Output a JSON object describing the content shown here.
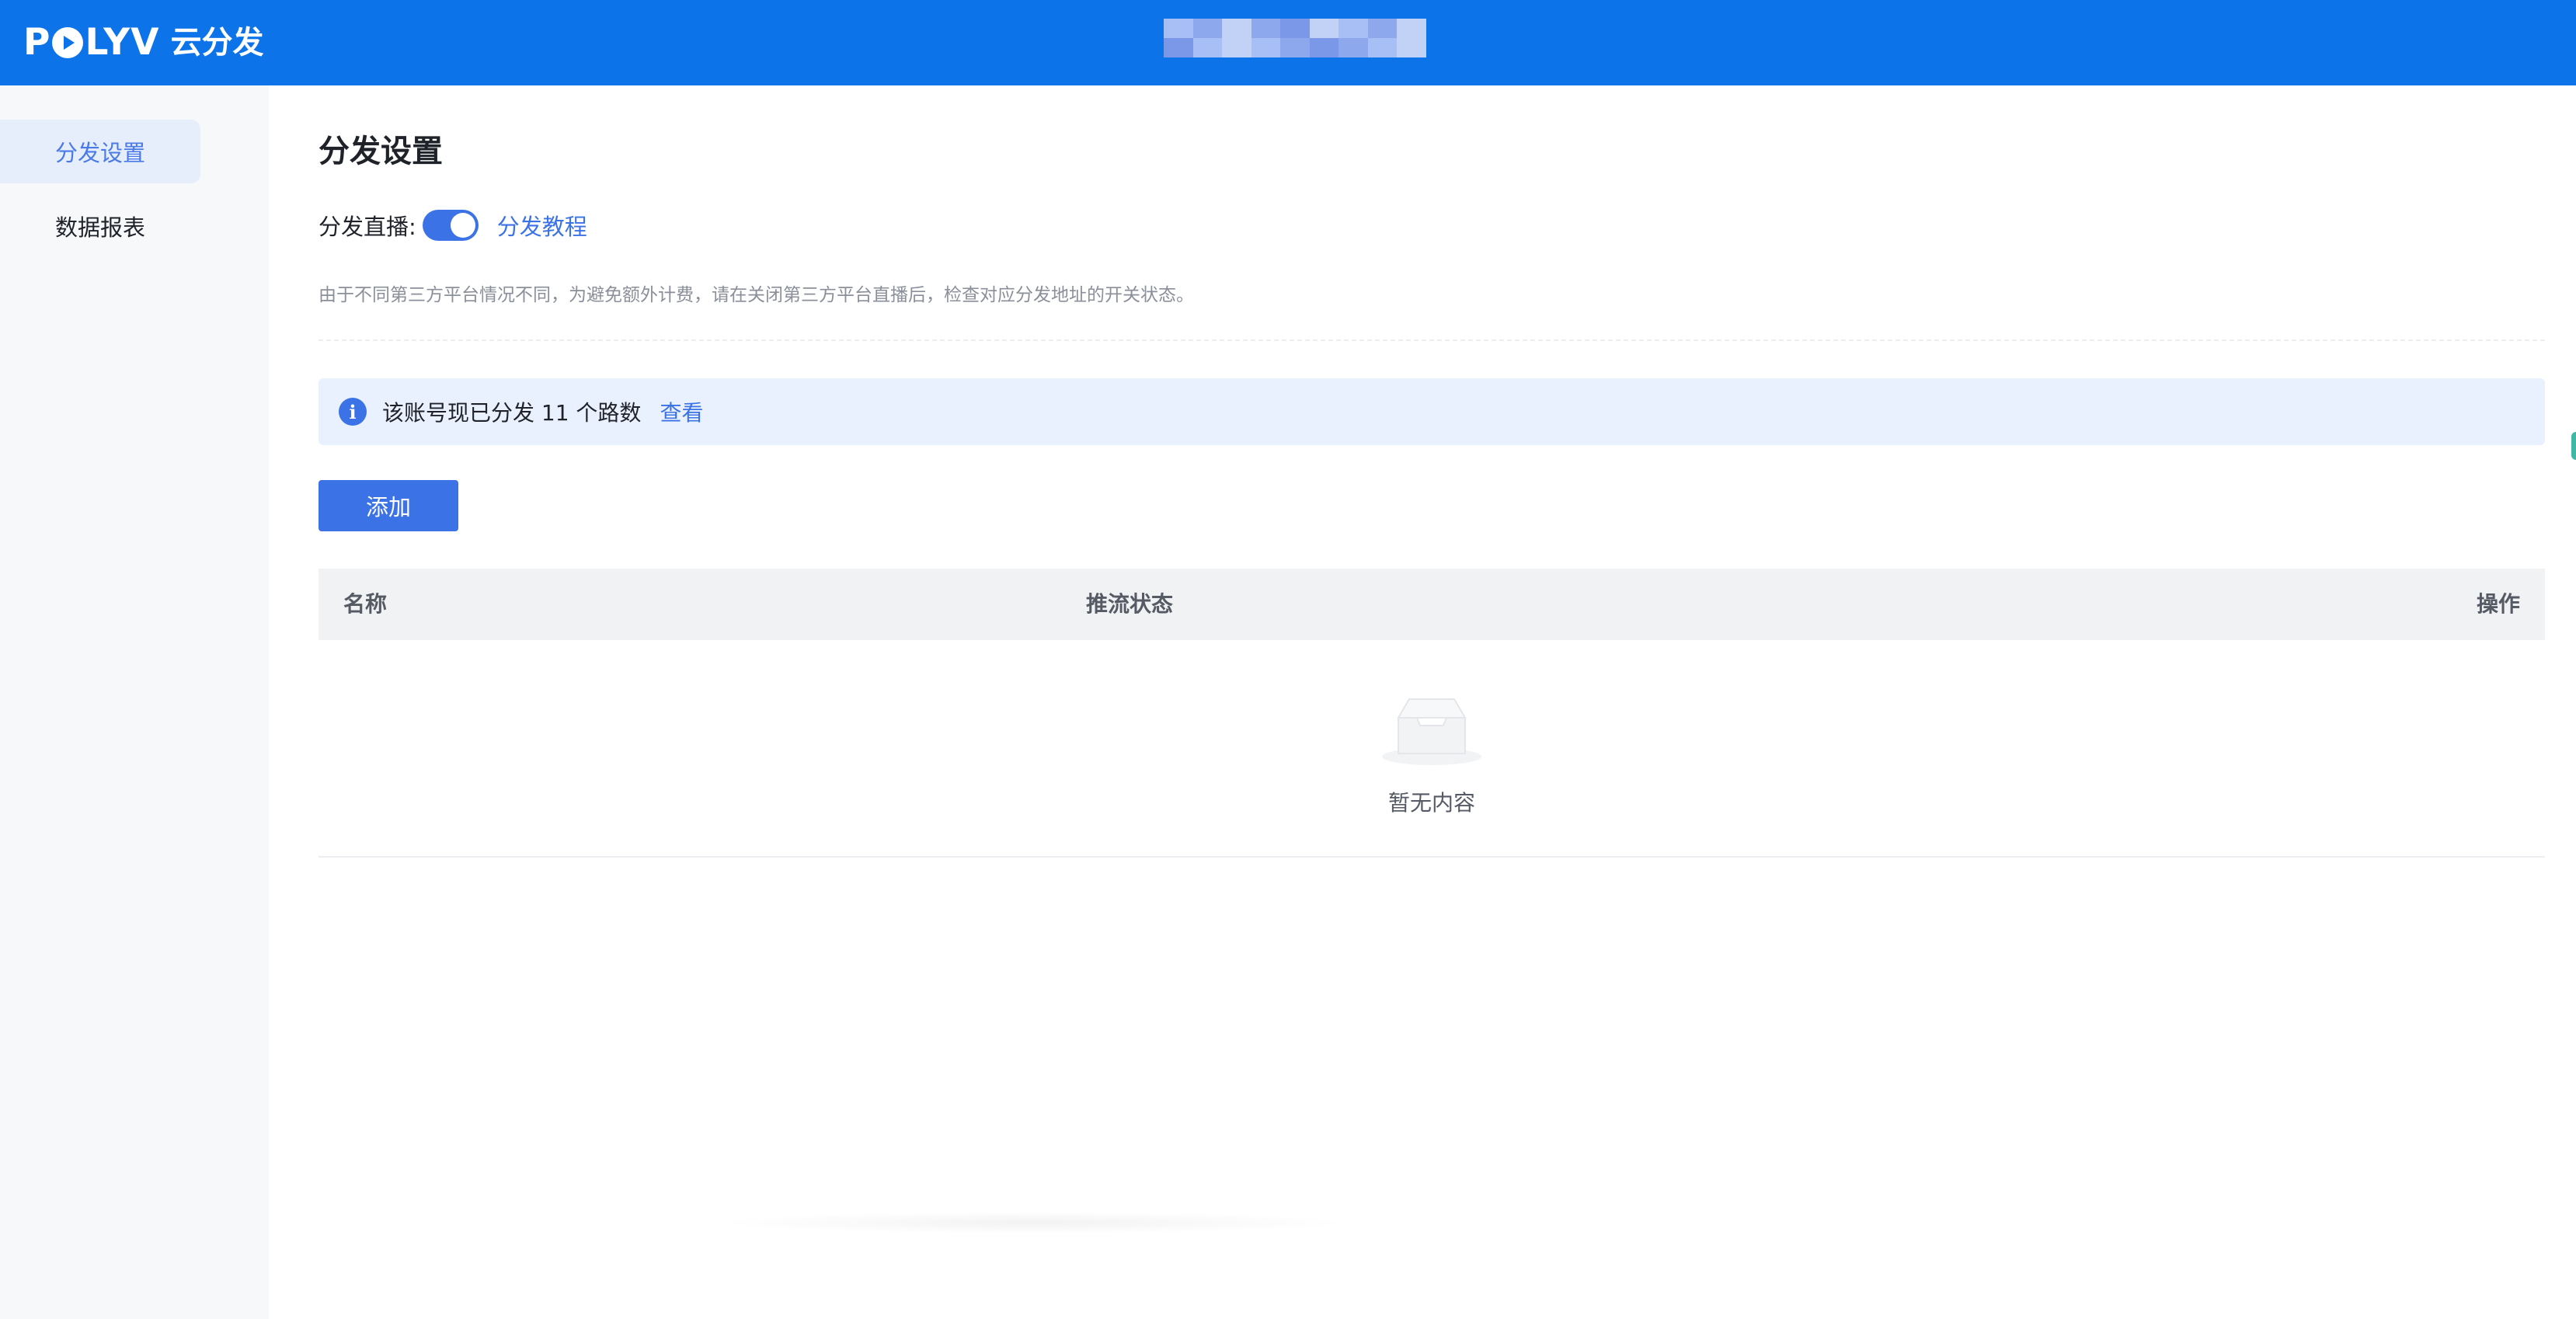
{
  "header": {
    "brand": "POLYV",
    "product": "云分发"
  },
  "sidebar": {
    "items": [
      {
        "label": "分发设置",
        "active": true
      },
      {
        "label": "数据报表",
        "active": false
      }
    ]
  },
  "main": {
    "title": "分发设置",
    "live_label": "分发直播:",
    "live_enabled": true,
    "tutorial_link": "分发教程",
    "notice": "由于不同第三方平台情况不同，为避免额外计费，请在关闭第三方平台直播后，检查对应分发地址的开关状态。",
    "info_text": "该账号现已分发 11 个路数",
    "info_link": "查看",
    "add_button": "添加",
    "table": {
      "columns": [
        "名称",
        "推流状态",
        "操作"
      ],
      "rows": [],
      "empty_text": "暂无内容"
    }
  },
  "colors": {
    "header_bg": "#0c73e8",
    "accent": "#3b72e6",
    "info_bg": "#eaf1fe",
    "sidebar_bg": "#f7f8fa"
  }
}
